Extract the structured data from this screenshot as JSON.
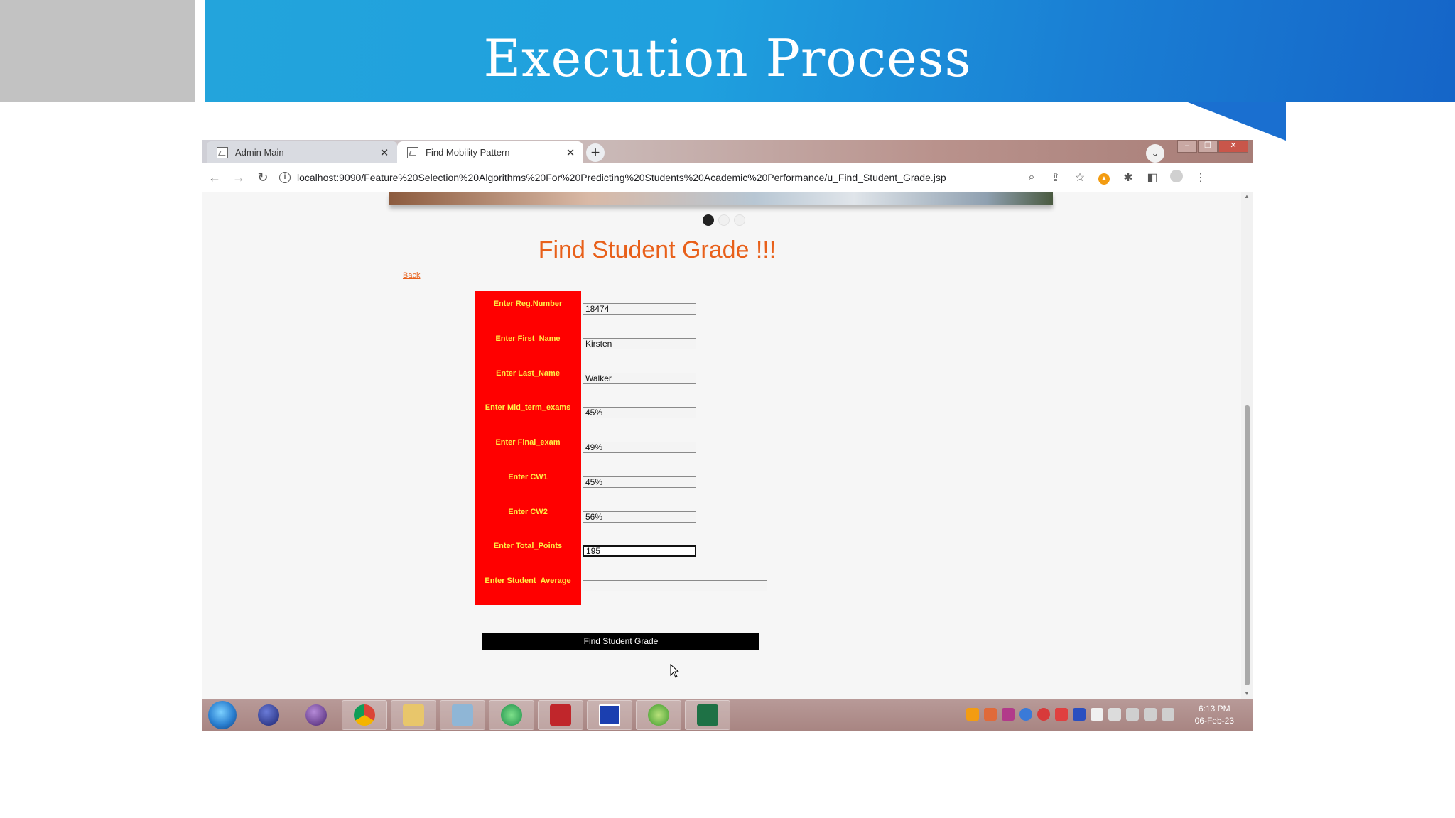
{
  "slide": {
    "title": "Execution Process"
  },
  "browser": {
    "tabs": [
      {
        "label": "Admin Main"
      },
      {
        "label": "Find Mobility Pattern"
      }
    ],
    "new_tab": "+",
    "url": "localhost:9090/Feature%20Selection%20Algorithms%20For%20Predicting%20Students%20Academic%20Performance/u_Find_Student_Grade.jsp"
  },
  "page": {
    "title": "Find Student Grade !!!",
    "back_link": "Back",
    "carousel_active_index": 0,
    "fields": [
      {
        "label": "Enter Reg.Number",
        "value": "18474"
      },
      {
        "label": "Enter First_Name",
        "value": "Kirsten"
      },
      {
        "label": "Enter Last_Name",
        "value": "Walker"
      },
      {
        "label": "Enter Mid_term_exams",
        "value": "45%"
      },
      {
        "label": "Enter Final_exam",
        "value": "49%"
      },
      {
        "label": "Enter CW1",
        "value": "45%"
      },
      {
        "label": "Enter CW2",
        "value": "56%"
      },
      {
        "label": "Enter Total_Points",
        "value": "195"
      },
      {
        "label": "Enter Student_Average",
        "value": ""
      }
    ],
    "submit_label": "Find Student Grade"
  },
  "taskbar": {
    "time": "6:13 PM",
    "date": "06-Feb-23",
    "apps": [
      "eclipse-icon",
      "eclipse-alt-icon",
      "chrome-icon",
      "file-explorer-icon",
      "notes-icon",
      "network-icon",
      "pdf-reader-icon",
      "remote-app-icon",
      "sync-icon",
      "excel-icon"
    ]
  },
  "colors": {
    "banner": "#1fa0de",
    "form_label_bg": "#ff0000",
    "form_label_text": "#ffee44",
    "title_orange": "#e8601a",
    "button_bg": "#000000"
  }
}
